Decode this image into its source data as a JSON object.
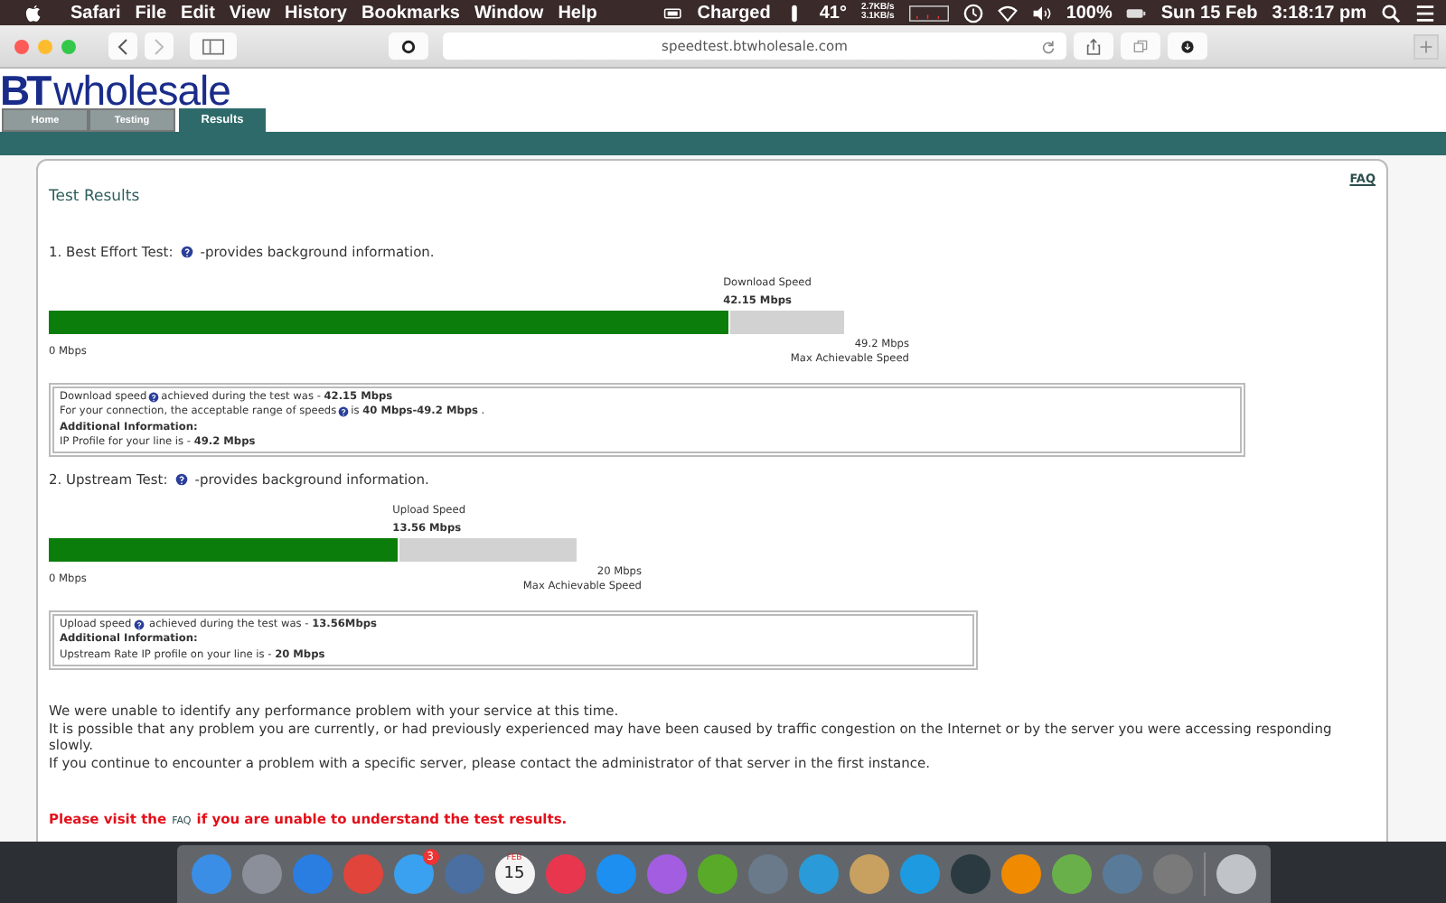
{
  "menubar": {
    "menus": [
      "Safari",
      "File",
      "Edit",
      "View",
      "History",
      "Bookmarks",
      "Window",
      "Help"
    ],
    "battery_label": "Charged",
    "temperature": "41°",
    "net_up": "2.7KB/s",
    "net_down": "3.1KB/s",
    "battery_percent": "100%",
    "date": "Sun 15 Feb",
    "time": "3:18:17 pm"
  },
  "toolbar": {
    "url": "speedtest.btwholesale.com"
  },
  "site": {
    "logo_bold": "BT",
    "logo_text": "wholesale",
    "tabs": [
      {
        "label": "Home",
        "selected": false
      },
      {
        "label": "Testing",
        "selected": false
      },
      {
        "label": "Results",
        "selected": true
      }
    ]
  },
  "panel": {
    "title": "Test Results",
    "faq_link": "FAQ",
    "tests": [
      {
        "heading": "1. Best Effort Test:",
        "heading_note": "-provides background information.",
        "speed_label": "Download Speed",
        "speed_value": "42.15 Mbps",
        "level": 0.857,
        "min_label": "0 Mbps",
        "max_value": "49.2 Mbps",
        "max_label": "Max Achievable Speed",
        "info": [
          {
            "kind": "text",
            "before": "Download speed",
            "icon": true,
            "after": "achieved during the test was - **42.15 Mbps**"
          },
          {
            "kind": "text",
            "before": "For your connection, the acceptable range of speeds",
            "icon": true,
            "after": "is **40 Mbps-49.2 Mbps** ."
          },
          {
            "kind": "heading",
            "before": "Additional Information:"
          },
          {
            "kind": "text",
            "before": "IP Profile for your line is - **49.2 Mbps**",
            "icon": false
          }
        ]
      },
      {
        "heading": "2. Upstream Test:",
        "heading_note": "-provides background information.",
        "speed_label": "Upload Speed",
        "speed_value": "13.56 Mbps",
        "level": 0.665,
        "min_label": "0 Mbps",
        "max_value": "20 Mbps",
        "max_label": "Max Achievable Speed",
        "info": [
          {
            "kind": "text",
            "before": "Upload speed",
            "icon": true,
            "after": " achieved during the test was - **13.56Mbps**"
          },
          {
            "kind": "heading",
            "before": "Additional Information:"
          },
          {
            "kind": "text",
            "before": "Upstream Rate IP profile on your line is - **20 Mbps**",
            "icon": false
          }
        ]
      }
    ],
    "messages": [
      "We were unable to identify any performance problem with your service at this time.",
      "It is possible that any problem you are currently, or had previously experienced may have been caused by traffic congestion on the Internet or by the server you were accessing responding slowly.",
      "If you continue to encounter a problem with a specific server, please contact the administrator of that server in the first instance."
    ],
    "notice_before": "Please visit the",
    "notice_link": "FAQ",
    "notice_after": "if you are unable to understand the test results."
  },
  "dock": {
    "apps": [
      {
        "color": "#3a8ee6"
      },
      {
        "color": "#8a8f99"
      },
      {
        "color": "#2a7de1"
      },
      {
        "color": "#e0443a"
      },
      {
        "color": "#3aa0f0",
        "badge": "3"
      },
      {
        "color": "#4a6fa0"
      },
      {
        "color": "#f4f4f4",
        "month": "FEB",
        "day": "15"
      },
      {
        "color": "#e8364f"
      },
      {
        "color": "#1d8ff0"
      },
      {
        "color": "#a25de0"
      },
      {
        "color": "#5aaa2a"
      },
      {
        "color": "#6a7a8a"
      },
      {
        "color": "#2a9ad8"
      },
      {
        "color": "#c8a060"
      },
      {
        "color": "#1e9be0"
      },
      {
        "color": "#2a3a40"
      },
      {
        "color": "#f08a00"
      },
      {
        "color": "#6ab04a"
      },
      {
        "color": "#5a7a9a"
      },
      {
        "color": "#7a7a7a"
      },
      {
        "color": "#c0c4c8"
      }
    ]
  }
}
